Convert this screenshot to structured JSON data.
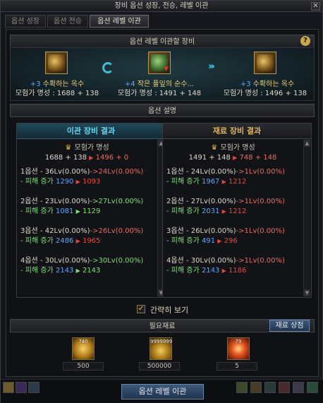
{
  "window": {
    "title": "장비 옵션 성장, 전승, 레벨 이관"
  },
  "tabs": [
    {
      "label": "옵션 성장",
      "active": false
    },
    {
      "label": "옵션 전승",
      "active": false
    },
    {
      "label": "옵션 레벨 이관",
      "active": true
    }
  ],
  "transfer": {
    "header": "옵션 레벨 이관할 장비",
    "help": "?",
    "source": {
      "name": "+3 수확하는 옥수",
      "plus": "+3",
      "short": "수확하는 옥수",
      "fame": "모험가 명성 : 1688 + 138"
    },
    "material": {
      "plus": "+4",
      "short": "작은 풀잎의 순수...",
      "fame": "모험가 명성 : 1491 + 148"
    },
    "result": {
      "plus": "+3",
      "short": "수확하는 옥수",
      "fame": "모험가 명성 : 1496 + 138"
    }
  },
  "description": {
    "header": "옵션 설명"
  },
  "left_result": {
    "title": "이관 장비 결과",
    "fame_label": "모험가 명성",
    "fame_before": "1688 + 138",
    "fame_after": "1496 + 0",
    "options": [
      {
        "line": "1옵션 - 36Lv(0.00%)",
        "arrow": "->",
        "after": "24Lv(0.00%)",
        "dmg_label": "- 피해 증가",
        "dmg_before": "1290",
        "dmg_after": "1093",
        "trend": "down"
      },
      {
        "line": "2옵션 - 23Lv(0.00%)",
        "arrow": "->",
        "after": "27Lv(0.00%)",
        "dmg_label": "- 피해 증가",
        "dmg_before": "1081",
        "dmg_after": "1129",
        "trend": "up"
      },
      {
        "line": "3옵션 - 42Lv(0.00%)",
        "arrow": "->",
        "after": "26Lv(0.00%)",
        "dmg_label": "- 피해 증가",
        "dmg_before": "2486",
        "dmg_after": "1965",
        "trend": "down"
      },
      {
        "line": "4옵션 - 30Lv(0.00%)",
        "arrow": "->",
        "after": "30Lv(0.00%)",
        "dmg_label": "- 피해 증가",
        "dmg_before": "2143",
        "dmg_after": "2143",
        "trend": "same"
      }
    ]
  },
  "right_result": {
    "title": "재료 장비 결과",
    "fame_label": "모험가 명성",
    "fame_before": "1491 + 148",
    "fame_after": "748 + 148",
    "options": [
      {
        "line": "1옵션 - 24Lv(0.00%)",
        "arrow": "->",
        "after": "1Lv(0.00%)",
        "dmg_label": "- 피해 증가",
        "dmg_before": "1967",
        "dmg_after": "1212",
        "trend": "down"
      },
      {
        "line": "2옵션 - 27Lv(0.00%)",
        "arrow": "->",
        "after": "1Lv(0.00%)",
        "dmg_label": "- 피해 증가",
        "dmg_before": "2031",
        "dmg_after": "1212",
        "trend": "down"
      },
      {
        "line": "3옵션 - 26Lv(0.00%)",
        "arrow": "->",
        "after": "1Lv(0.00%)",
        "dmg_label": "- 피해 증가",
        "dmg_before": "491",
        "dmg_after": "296",
        "trend": "down"
      },
      {
        "line": "4옵션 - 30Lv(0.00%)",
        "arrow": "->",
        "after": "1Lv(0.00%)",
        "dmg_label": "- 피해 증가",
        "dmg_before": "2143",
        "dmg_after": "1186",
        "trend": "down"
      }
    ]
  },
  "simple_view": {
    "label": "간략히 보기",
    "checked": true
  },
  "materials": {
    "header": "필요재료",
    "shop_button": "재료 상점",
    "items": [
      {
        "icon": "crystal-icon",
        "badge": "740",
        "required": "500"
      },
      {
        "icon": "gold-icon",
        "badge": "9999999",
        "required": "500000"
      },
      {
        "icon": "essence-icon",
        "badge": "79",
        "required": "5"
      }
    ]
  },
  "action_button": "옵션 레벨 이관",
  "colors": {
    "up": "#7ee07a",
    "down": "#e8473e",
    "same": "#7ee07a",
    "accent": "#6fd3f0"
  }
}
